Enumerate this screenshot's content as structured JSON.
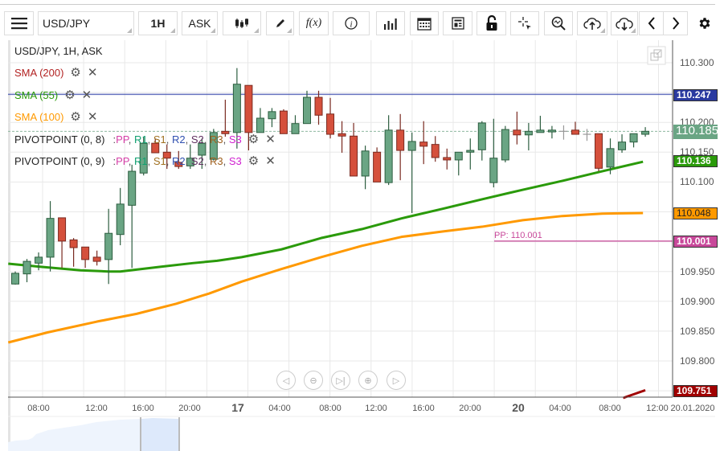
{
  "toolbar": {
    "menu_icon": "hamburger-icon",
    "symbol": "USD/JPY",
    "timeframe": "1H",
    "price_type": "ASK",
    "fx_label": "f(x)",
    "icons": [
      "candlestick-icon",
      "pencil-icon",
      "function-icon",
      "info-icon",
      "bar-chart-icon",
      "calendar-icon",
      "news-icon",
      "unlock-icon",
      "crosshair-icon",
      "zoom-icon",
      "upload-cloud-icon",
      "download-cloud-icon",
      "chevron-left-icon",
      "chevron-right-icon",
      "gear-icon"
    ]
  },
  "legend": {
    "title": "USD/JPY, 1H, ASK",
    "sma200": "SMA (200)",
    "sma55": "SMA (55)",
    "sma100": "SMA (100)",
    "pivot1": "PIVOTPOINT (0, 8)",
    "pivot2": "PIVOTPOINT (0, 9)",
    "pivot_sep": ":",
    "pivot_levels": [
      "PP",
      "R1",
      "S1",
      "R2",
      "S2",
      "R3",
      "S3"
    ],
    "pivot_colors": [
      "#d63fa8",
      "#10a070",
      "#a07020",
      "#3050b0",
      "#603060",
      "#a06020",
      "#d020d0"
    ]
  },
  "colors": {
    "up": "#6aa584",
    "down": "#d5503c",
    "sma55": "#2a9a0a",
    "sma100": "#ff9900",
    "sma200": "#a00000",
    "hline": "#4050b0",
    "pp": "#c8489a"
  },
  "price_labels": {
    "hline": "110.247",
    "current": "110.185",
    "sma55": "110.136",
    "sma100": "110.048",
    "pp": "110.001",
    "sma200": "109.751"
  },
  "pp_text": "PP: 110.001",
  "time_axis": {
    "labels": [
      "08:00",
      "12:00",
      "16:00",
      "20:00",
      "17",
      "04:00",
      "08:00",
      "12:00",
      "16:00",
      "20:00",
      "20",
      "04:00",
      "08:00",
      "12:00"
    ],
    "date": "20.01.2020"
  },
  "nav_buttons": [
    "scroll-left",
    "zoom-out",
    "go-to-latest",
    "zoom-in",
    "scroll-right"
  ],
  "chart_data": {
    "type": "candlestick",
    "symbol": "USD/JPY",
    "ylim": [
      109.745,
      110.335
    ],
    "yticks": [
      "110.300",
      "110.200",
      "110.150",
      "110.100",
      "109.950",
      "109.900",
      "109.850",
      "109.800"
    ],
    "yticks_values": [
      110.3,
      110.2,
      110.15,
      110.1,
      109.95,
      109.9,
      109.85,
      109.8
    ],
    "ohlc": [
      [
        109.929,
        109.95,
        109.928,
        109.947
      ],
      [
        109.946,
        109.971,
        109.932,
        109.967
      ],
      [
        109.964,
        109.982,
        109.952,
        109.974
      ],
      [
        109.974,
        110.068,
        109.95,
        110.039
      ],
      [
        110.04,
        110.04,
        109.956,
        110.001
      ],
      [
        110.003,
        110.006,
        109.958,
        109.99
      ],
      [
        109.991,
        109.991,
        109.956,
        109.97
      ],
      [
        109.974,
        109.985,
        109.96,
        109.967
      ],
      [
        109.97,
        110.055,
        109.929,
        110.014
      ],
      [
        110.012,
        110.09,
        109.994,
        110.063
      ],
      [
        110.061,
        110.129,
        109.956,
        110.118
      ],
      [
        110.115,
        110.176,
        110.111,
        110.165
      ],
      [
        110.165,
        110.172,
        110.149,
        110.149
      ],
      [
        110.15,
        110.163,
        110.122,
        110.14
      ],
      [
        110.133,
        110.152,
        110.122,
        110.126
      ],
      [
        110.127,
        110.163,
        110.122,
        110.14
      ],
      [
        110.145,
        110.173,
        110.122,
        110.165
      ],
      [
        110.138,
        110.189,
        110.136,
        110.183
      ],
      [
        110.185,
        110.238,
        110.176,
        110.181
      ],
      [
        110.183,
        110.291,
        110.156,
        110.264
      ],
      [
        110.262,
        110.262,
        110.153,
        110.183
      ],
      [
        110.183,
        110.224,
        110.183,
        110.207
      ],
      [
        110.206,
        110.224,
        110.192,
        110.218
      ],
      [
        110.219,
        110.222,
        110.181,
        110.181
      ],
      [
        110.181,
        110.212,
        110.181,
        110.198
      ],
      [
        110.198,
        110.253,
        110.198,
        110.242
      ],
      [
        110.242,
        110.253,
        110.196,
        110.212
      ],
      [
        110.214,
        110.241,
        110.173,
        110.18
      ],
      [
        110.181,
        110.202,
        110.149,
        110.177
      ],
      [
        110.177,
        110.199,
        110.11,
        110.11
      ],
      [
        110.11,
        110.161,
        110.088,
        110.152
      ],
      [
        110.15,
        110.158,
        110.1,
        110.1
      ],
      [
        110.099,
        110.212,
        110.095,
        110.187
      ],
      [
        110.187,
        110.214,
        110.103,
        110.153
      ],
      [
        110.153,
        110.183,
        110.048,
        110.168
      ],
      [
        110.167,
        110.202,
        110.13,
        110.16
      ],
      [
        110.163,
        110.177,
        110.134,
        110.141
      ],
      [
        110.141,
        110.156,
        110.121,
        110.137
      ],
      [
        110.137,
        110.15,
        110.111,
        110.15
      ],
      [
        110.15,
        110.173,
        110.121,
        110.153
      ],
      [
        110.154,
        110.202,
        110.136,
        110.199
      ],
      [
        110.099,
        110.206,
        110.091,
        110.14
      ],
      [
        110.137,
        110.194,
        110.133,
        110.188
      ],
      [
        110.187,
        110.218,
        110.163,
        110.179
      ],
      [
        110.179,
        110.199,
        110.153,
        110.185
      ],
      [
        110.183,
        110.211,
        110.183,
        110.187
      ],
      [
        110.184,
        110.194,
        110.173,
        110.187
      ],
      [
        110.185,
        110.195,
        110.171,
        110.185
      ],
      [
        110.187,
        110.201,
        110.18,
        110.18
      ],
      [
        110.18,
        110.189,
        110.169,
        110.18
      ],
      [
        110.181,
        110.181,
        110.118,
        110.123
      ],
      [
        110.125,
        110.173,
        110.113,
        110.156
      ],
      [
        110.154,
        110.18,
        110.149,
        110.167
      ],
      [
        110.167,
        110.181,
        110.158,
        110.181
      ],
      [
        110.18,
        110.192,
        110.176,
        110.185
      ]
    ],
    "sma55": [
      [
        -0.6,
        109.963
      ],
      [
        2.1,
        109.958
      ],
      [
        5.6,
        109.952
      ],
      [
        8,
        109.95
      ],
      [
        9,
        109.95
      ],
      [
        12.5,
        109.958
      ],
      [
        15.2,
        109.964
      ],
      [
        17.3,
        109.968
      ],
      [
        19.4,
        109.974
      ],
      [
        22.8,
        109.987
      ],
      [
        26.2,
        110.006
      ],
      [
        29.7,
        110.021
      ],
      [
        33.1,
        110.039
      ],
      [
        36.6,
        110.055
      ],
      [
        40,
        110.071
      ],
      [
        43.5,
        110.087
      ],
      [
        46.9,
        110.102
      ],
      [
        50.3,
        110.118
      ],
      [
        53.8,
        110.134
      ]
    ],
    "sma100": [
      [
        -0.6,
        109.831
      ],
      [
        2.8,
        109.848
      ],
      [
        7,
        109.866
      ],
      [
        10.4,
        109.879
      ],
      [
        13.8,
        109.896
      ],
      [
        16.6,
        109.913
      ],
      [
        19.4,
        109.933
      ],
      [
        22.8,
        109.954
      ],
      [
        26.2,
        109.974
      ],
      [
        29.7,
        109.993
      ],
      [
        33.1,
        110.008
      ],
      [
        36.6,
        110.017
      ],
      [
        40,
        110.025
      ],
      [
        43.5,
        110.036
      ],
      [
        46.9,
        110.043
      ],
      [
        50.3,
        110.047
      ],
      [
        53.8,
        110.048
      ]
    ],
    "sma200": [
      [
        52.1,
        109.738
      ],
      [
        54,
        109.751
      ]
    ],
    "hline": 110.247,
    "pivot_pp": 110.001,
    "current_price": 110.185
  }
}
